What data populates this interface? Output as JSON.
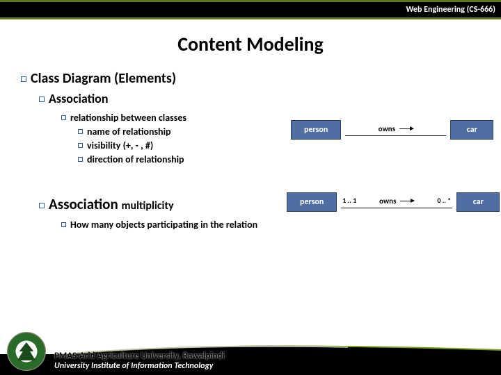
{
  "header": {
    "course": "Web Engineering (CS-666)"
  },
  "title": "Content Modeling",
  "bullets": {
    "l1": "Class Diagram (Elements)",
    "l2a": "Association",
    "l3a": "relationship between classes",
    "l4a": "name of relationship",
    "l4b": "visibility (+, - , #)",
    "l4c": "direction of relationship",
    "l2b_main": "Association",
    "l2b_sub": "multiplicity",
    "l3b": "How many objects participating in the relation"
  },
  "diagram1": {
    "left": "person",
    "relation": "owns",
    "right": "car"
  },
  "diagram2": {
    "left": "person",
    "mult_left": "1 .. 1",
    "relation": "owns",
    "mult_right": "0 .. *",
    "right": "car"
  },
  "footer": {
    "line1": "PMAS-Arid Agriculture University, Rawalpindi",
    "line2": "University Institute of Information Technology"
  }
}
